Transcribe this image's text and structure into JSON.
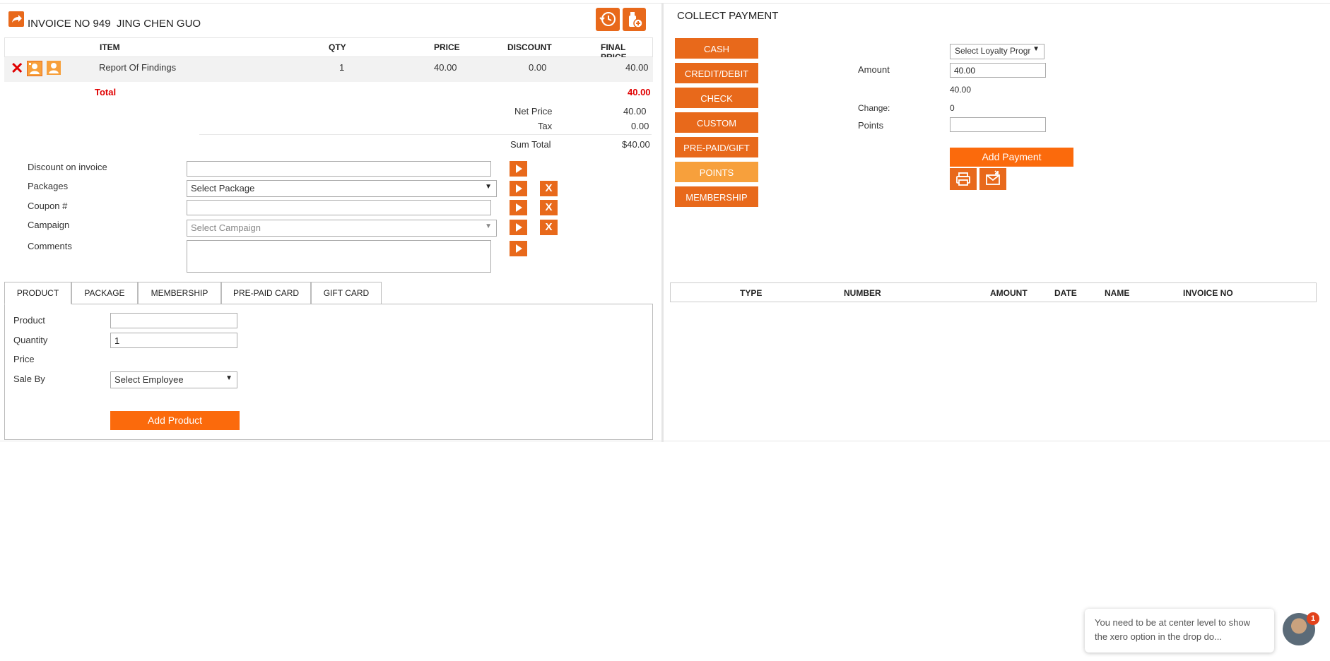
{
  "invoice": {
    "title": "INVOICE NO 949",
    "customer": "JING CHEN GUO",
    "columns": [
      "ITEM",
      "QTY",
      "PRICE",
      "DISCOUNT",
      "FINAL PRICE"
    ],
    "rows": [
      {
        "item": "Report Of Findings",
        "qty": "1",
        "price": "40.00",
        "discount": "0.00",
        "final": "40.00"
      }
    ],
    "total_label": "Total",
    "total_value": "40.00",
    "net_price_label": "Net Price",
    "net_price_value": "40.00",
    "tax_label": "Tax",
    "tax_value": "0.00",
    "sum_total_label": "Sum Total",
    "sum_total_value": "$40.00"
  },
  "form": {
    "discount_label": "Discount on invoice",
    "packages_label": "Packages",
    "packages_value": "Select Package",
    "coupon_label": "Coupon #",
    "campaign_label": "Campaign",
    "campaign_placeholder": "Select Campaign",
    "comments_label": "Comments",
    "x_label": "X"
  },
  "tabs": [
    {
      "label": "PRODUCT"
    },
    {
      "label": "PACKAGE"
    },
    {
      "label": "MEMBERSHIP"
    },
    {
      "label": "PRE-PAID CARD"
    },
    {
      "label": "GIFT CARD"
    }
  ],
  "product_form": {
    "product_label": "Product",
    "quantity_label": "Quantity",
    "quantity_value": "1",
    "price_label": "Price",
    "sale_by_label": "Sale By",
    "employee_value": "Select Employee",
    "add_button": "Add Product"
  },
  "payment": {
    "title": "COLLECT PAYMENT",
    "methods": [
      "CASH",
      "CREDIT/DEBIT",
      "CHECK",
      "CUSTOM",
      "PRE-PAID/GIFT",
      "POINTS",
      "MEMBERSHIP"
    ],
    "active_method": "POINTS",
    "loyalty_value": "Select Loyalty Progr",
    "amount_label": "Amount",
    "amount_value": "40.00",
    "amount_display": "40.00",
    "change_label": "Change:",
    "change_value": "0",
    "points_label": "Points",
    "add_button": "Add Payment",
    "columns": [
      "TYPE",
      "NUMBER",
      "AMOUNT",
      "DATE",
      "NAME",
      "INVOICE NO"
    ]
  },
  "chat": {
    "message": "You need to be at center level to show the xero option in the drop do...",
    "badge": "1"
  },
  "colors": {
    "accent": "#e8691b",
    "accent_light": "#f7a03c",
    "total_red": "#e00000"
  }
}
